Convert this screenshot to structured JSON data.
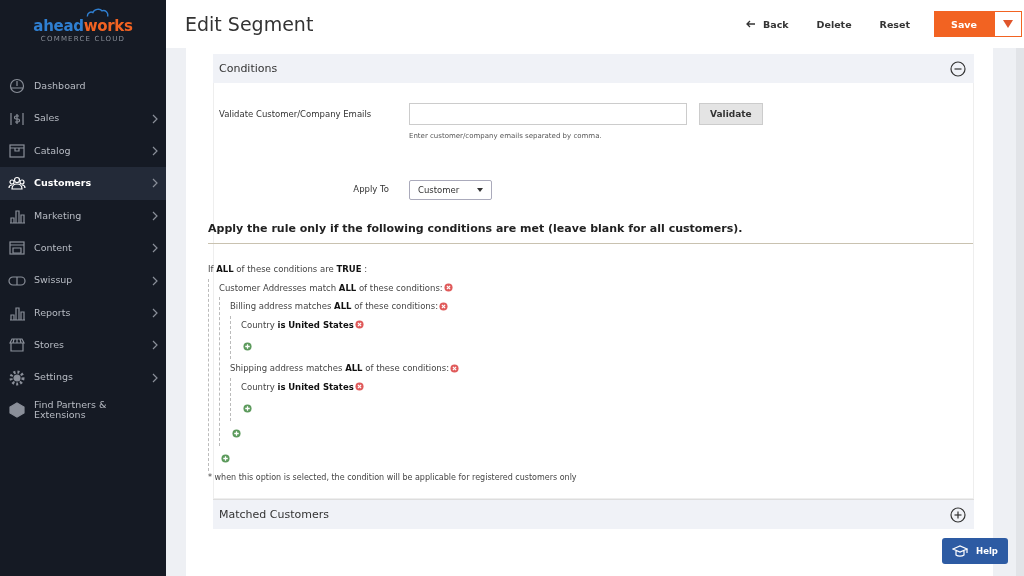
{
  "logo": {
    "part1": "ahead",
    "part2": "works",
    "tagline": "COMMERCE CLOUD"
  },
  "sidebar": {
    "items": [
      {
        "label": "Dashboard",
        "selected": false,
        "has_submenu": false
      },
      {
        "label": "Sales",
        "selected": false,
        "has_submenu": true
      },
      {
        "label": "Catalog",
        "selected": false,
        "has_submenu": true
      },
      {
        "label": "Customers",
        "selected": true,
        "has_submenu": true
      },
      {
        "label": "Marketing",
        "selected": false,
        "has_submenu": true
      },
      {
        "label": "Content",
        "selected": false,
        "has_submenu": true
      },
      {
        "label": "Swissup",
        "selected": false,
        "has_submenu": true
      },
      {
        "label": "Reports",
        "selected": false,
        "has_submenu": true
      },
      {
        "label": "Stores",
        "selected": false,
        "has_submenu": true
      },
      {
        "label": "Settings",
        "selected": false,
        "has_submenu": true
      },
      {
        "label": "Find Partners & Extensions",
        "selected": false,
        "has_submenu": false
      }
    ]
  },
  "header": {
    "title": "Edit Segment",
    "back": "Back",
    "delete": "Delete",
    "reset": "Reset",
    "save": "Save"
  },
  "conditions": {
    "title": "Conditions",
    "expanded": true,
    "email_label": "Validate Customer/Company Emails",
    "email_note": "Enter customer/company emails separated by comma.",
    "validate": "Validate",
    "apply_label": "Apply To",
    "apply_value": "Customer",
    "rule_heading": "Apply the rule only if the following conditions are met (leave blank for all customers).",
    "tree": {
      "text": "If **ALL**  of these conditions are **TRUE** :",
      "removable": false,
      "children": [
        {
          "text": "Customer Addresses match **ALL**  of these conditions:",
          "removable": true,
          "children": [
            {
              "text": "Billing address matches **ALL**  of these conditions:",
              "removable": true,
              "children": [
                {
                  "text": "Country  **is**  **United States**",
                  "removable": true
                }
              ]
            },
            {
              "text": "Shipping address matches **ALL**  of these conditions:",
              "removable": true,
              "children": [
                {
                  "text": "Country  **is**  **United States**",
                  "removable": true
                }
              ]
            }
          ]
        }
      ]
    },
    "footnote": "* when this option is selected, the condition will be applicable for registered customers only"
  },
  "matched": {
    "title": "Matched Customers",
    "expanded": false
  },
  "help": "Help"
}
